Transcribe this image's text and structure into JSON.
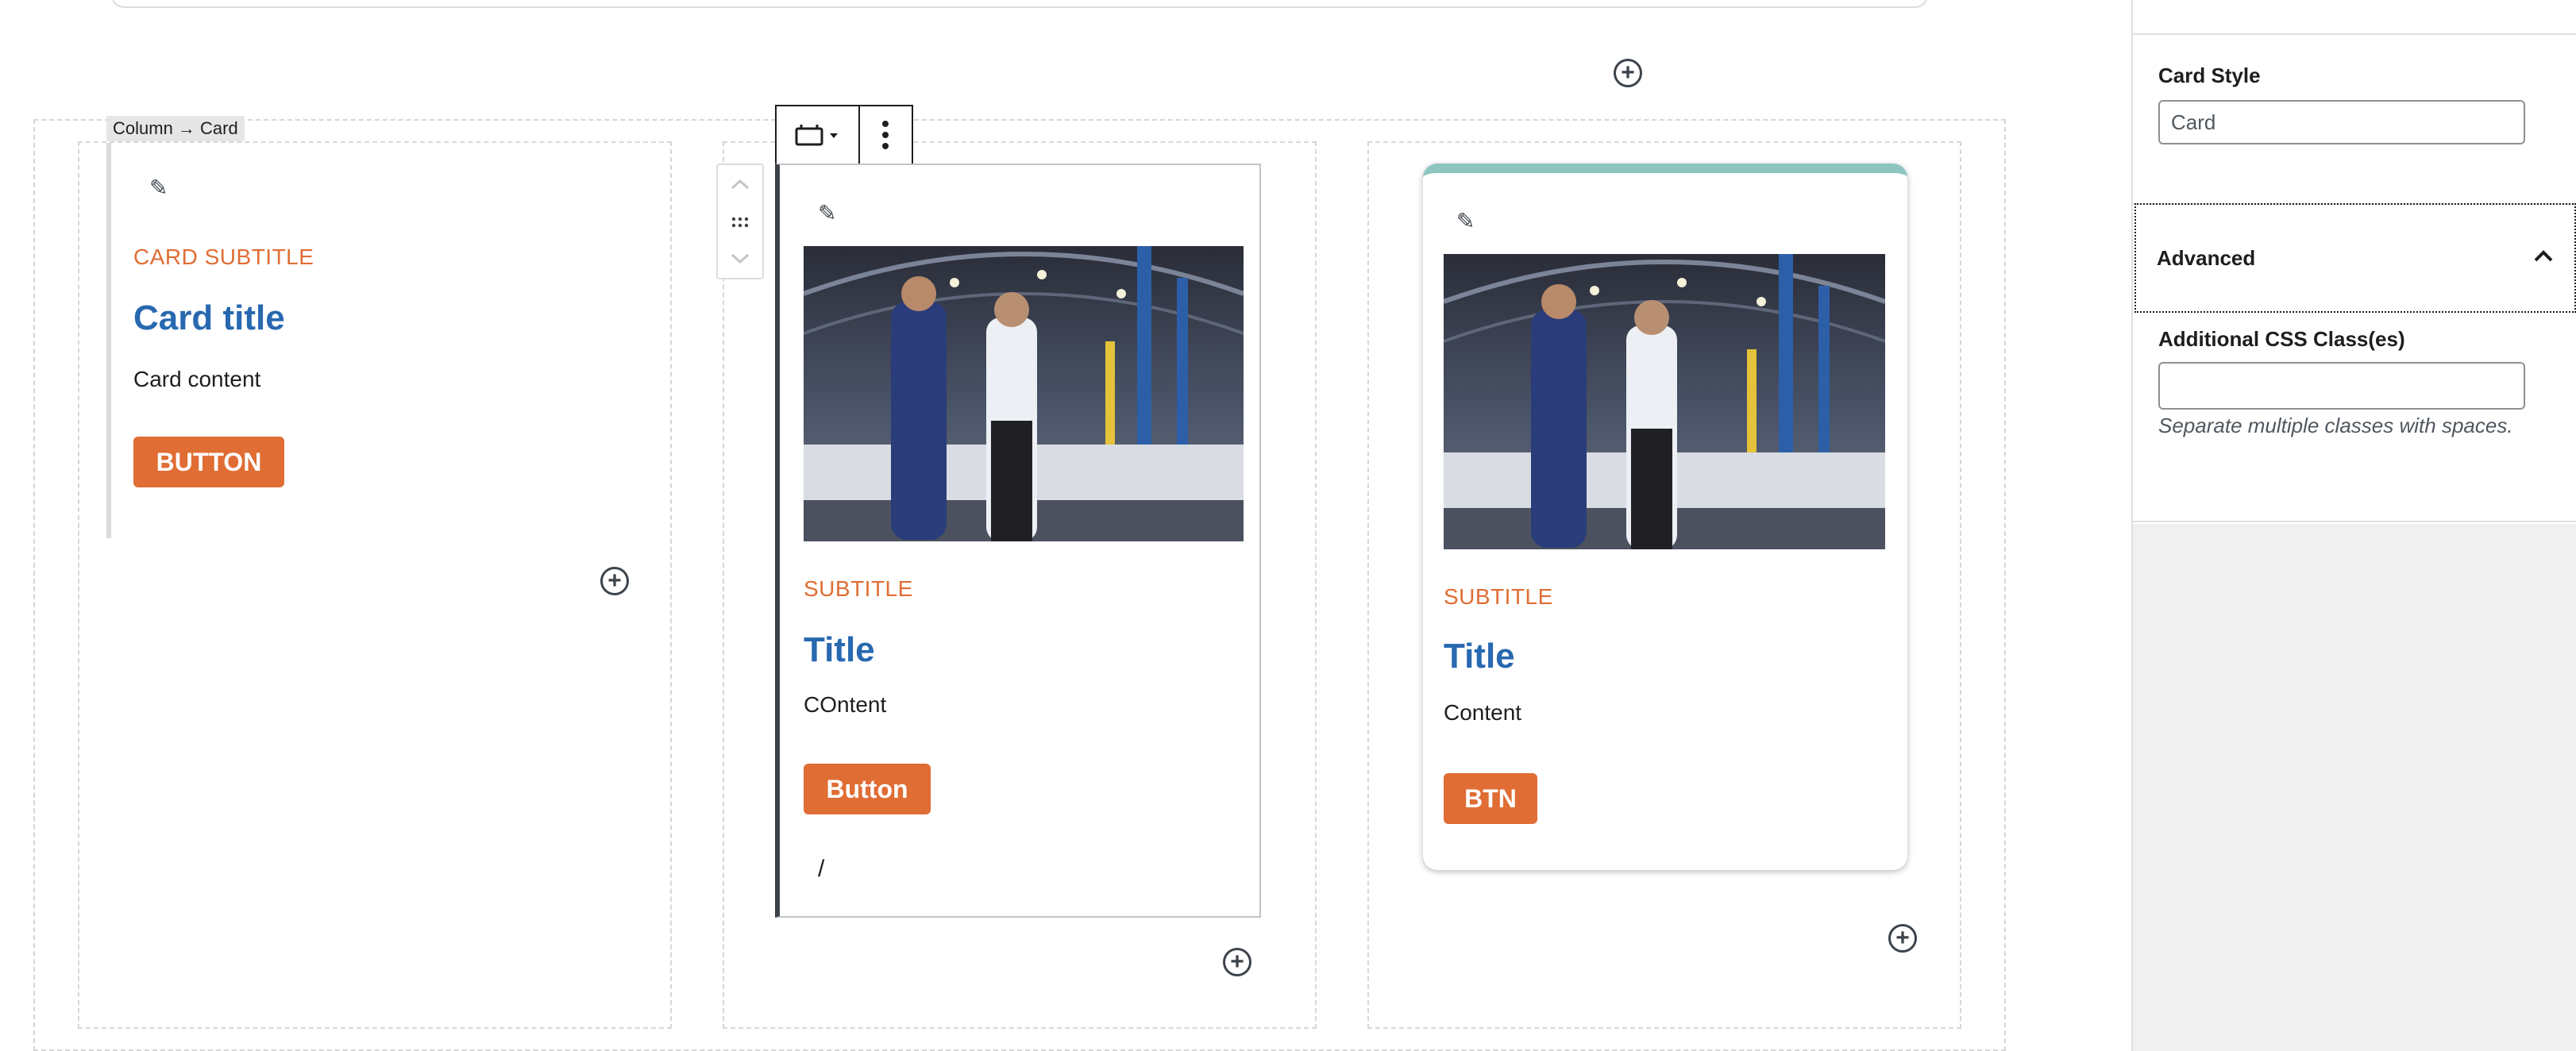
{
  "canvas": {
    "breadcrumb": "Column → Card"
  },
  "cards": [
    {
      "subtitle": "CARD SUBTITLE",
      "title": "Card title",
      "content": "Card content",
      "button": "BUTTON"
    },
    {
      "subtitle": "SUBTITLE",
      "title": "Title",
      "content": "COntent",
      "button": "Button",
      "footer_text": "/"
    },
    {
      "subtitle": "SUBTITLE",
      "title": "Title",
      "content": "Content",
      "button": "BTN",
      "accent_color": "#8ec5c0"
    }
  ],
  "sidebar": {
    "card_style_label": "Card Style",
    "card_style_value": "Card",
    "advanced_label": "Advanced",
    "css_class_label": "Additional CSS Class(es)",
    "css_class_value": "",
    "css_class_help": "Separate multiple classes with spaces."
  },
  "colors": {
    "accent_orange": "#e06d34",
    "title_blue": "#2868b0",
    "card_top_border": "#8ec5c0"
  },
  "icons": [
    "plus-circle-icon",
    "pencil-icon",
    "card-block-icon",
    "more-vertical-icon",
    "chevron-up-icon",
    "drag-handle-icon",
    "chevron-down-icon"
  ]
}
